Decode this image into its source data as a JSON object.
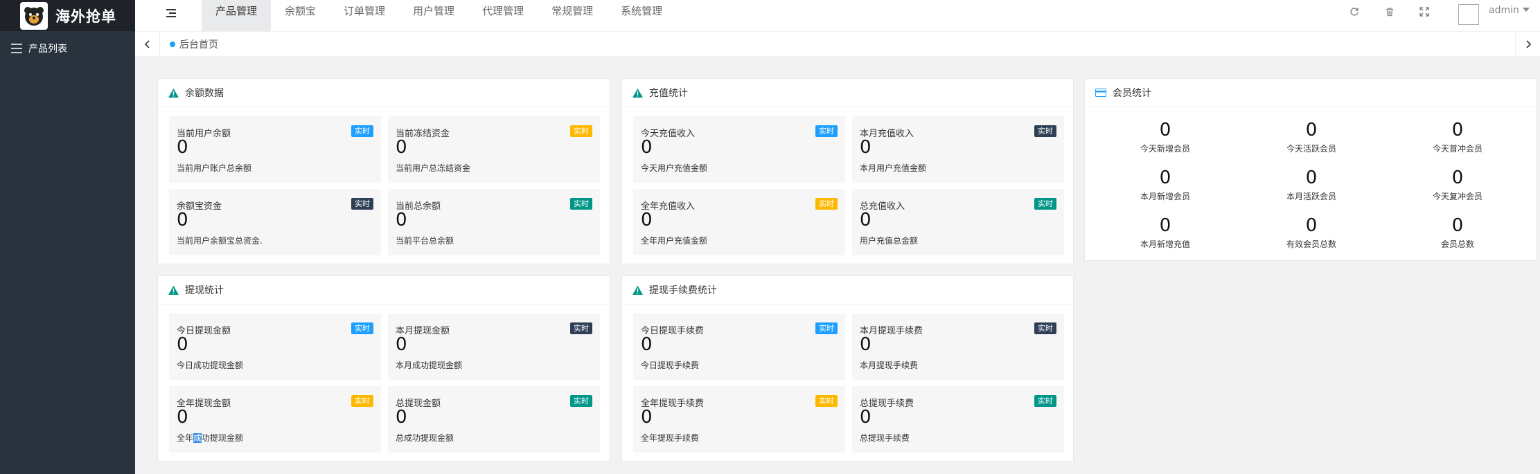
{
  "app": {
    "title": "海外抢单"
  },
  "sidebar": {
    "items": [
      {
        "label": "产品列表",
        "icon": "list-icon"
      }
    ]
  },
  "header": {
    "nav": [
      {
        "label": "产品管理",
        "active": true
      },
      {
        "label": "余额宝",
        "active": false
      },
      {
        "label": "订单管理",
        "active": false
      },
      {
        "label": "用户管理",
        "active": false
      },
      {
        "label": "代理管理",
        "active": false
      },
      {
        "label": "常规管理",
        "active": false
      },
      {
        "label": "系统管理",
        "active": false
      }
    ],
    "icons": [
      "refresh-icon",
      "trash-icon",
      "fullscreen-icon"
    ],
    "user": "admin"
  },
  "tabbar": {
    "home_label": "后台首页"
  },
  "colors": {
    "sidebar": "#28333e",
    "logo_bar": "#20222a",
    "blue": "#1e9fff",
    "orange": "#ffb800",
    "dark": "#2f4056",
    "green": "#009688"
  },
  "panels": {
    "balance": {
      "title": "余额数据",
      "cards": [
        {
          "label": "当前用户余额",
          "badge": "实时",
          "badge_color": "blue",
          "value": "0",
          "desc": "当前用户账户总余额"
        },
        {
          "label": "当前冻结资金",
          "badge": "实时",
          "badge_color": "orange",
          "value": "0",
          "desc": "当前用户总冻结资金"
        },
        {
          "label": "余额宝资金",
          "badge": "实时",
          "badge_color": "dark",
          "value": "0",
          "desc": "当前用户余额宝总资金."
        },
        {
          "label": "当前总余额",
          "badge": "实时",
          "badge_color": "green",
          "value": "0",
          "desc": "当前平台总余额"
        }
      ]
    },
    "recharge": {
      "title": "充值统计",
      "cards": [
        {
          "label": "今天充值收入",
          "badge": "实时",
          "badge_color": "blue",
          "value": "0",
          "desc": "今天用户充值金额"
        },
        {
          "label": "本月充值收入",
          "badge": "实时",
          "badge_color": "dark",
          "value": "0",
          "desc": "本月用户充值金额"
        },
        {
          "label": "全年充值收入",
          "badge": "实时",
          "badge_color": "orange",
          "value": "0",
          "desc": "全年用户充值金额"
        },
        {
          "label": "总充值收入",
          "badge": "实时",
          "badge_color": "green",
          "value": "0",
          "desc": "用户充值总金额"
        }
      ]
    },
    "members": {
      "title": "会员统计",
      "items": [
        {
          "value": "0",
          "label": "今天新增会员"
        },
        {
          "value": "0",
          "label": "今天活跃会员"
        },
        {
          "value": "0",
          "label": "今天首冲会员"
        },
        {
          "value": "0",
          "label": "本月新增会员"
        },
        {
          "value": "0",
          "label": "本月活跃会员"
        },
        {
          "value": "0",
          "label": "今天复冲会员"
        },
        {
          "value": "0",
          "label": "本月新增充值"
        },
        {
          "value": "0",
          "label": "有效会员总数"
        },
        {
          "value": "0",
          "label": "会员总数"
        }
      ]
    },
    "withdraw": {
      "title": "提现统计",
      "cards": [
        {
          "label": "今日提现金额",
          "badge": "实时",
          "badge_color": "blue",
          "value": "0",
          "desc": "今日成功提现金额"
        },
        {
          "label": "本月提现金额",
          "badge": "实时",
          "badge_color": "dark",
          "value": "0",
          "desc": "本月成功提现金额"
        },
        {
          "label": "全年提现金额",
          "badge": "实时",
          "badge_color": "orange",
          "value": "0",
          "desc_before": "全年",
          "desc_selected": "成",
          "desc_after": "功提现金额"
        },
        {
          "label": "总提现金额",
          "badge": "实时",
          "badge_color": "green",
          "value": "0",
          "desc": "总成功提现金额"
        }
      ]
    },
    "fee": {
      "title": "提现手续费统计",
      "cards": [
        {
          "label": "今日提现手续费",
          "badge": "实时",
          "badge_color": "blue",
          "value": "0",
          "desc": "今日提现手续费"
        },
        {
          "label": "本月提现手续费",
          "badge": "实时",
          "badge_color": "dark",
          "value": "0",
          "desc": "本月提现手续费"
        },
        {
          "label": "全年提现手续费",
          "badge": "实时",
          "badge_color": "orange",
          "value": "0",
          "desc": "全年提现手续费"
        },
        {
          "label": "总提现手续费",
          "badge": "实时",
          "badge_color": "green",
          "value": "0",
          "desc": "总提现手续费"
        }
      ]
    }
  }
}
